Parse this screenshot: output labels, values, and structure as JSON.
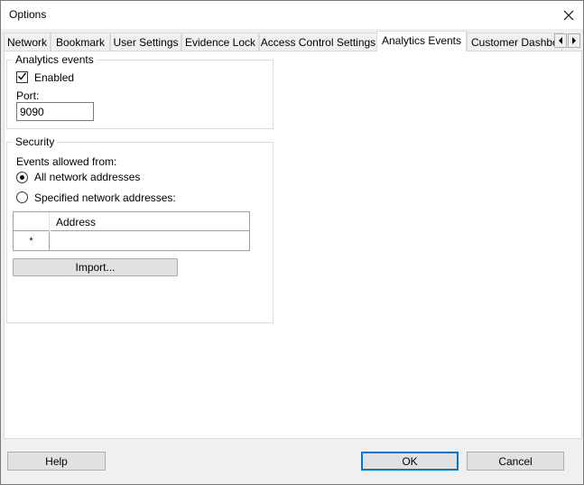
{
  "window": {
    "title": "Options",
    "close_icon": "close-icon"
  },
  "tabs": [
    {
      "label": "Network"
    },
    {
      "label": "Bookmark"
    },
    {
      "label": "User Settings"
    },
    {
      "label": "Evidence Lock"
    },
    {
      "label": "Access Control Settings"
    },
    {
      "label": "Analytics Events",
      "active": true
    },
    {
      "label": "Customer Dashboard"
    }
  ],
  "tab_scroll": {
    "left_icon": "chevron-left-icon",
    "right_icon": "chevron-right-icon"
  },
  "analytics": {
    "group_title": "Analytics events",
    "enabled_label": "Enabled",
    "enabled": true,
    "port_label": "Port:",
    "port_value": "9090"
  },
  "security": {
    "group_title": "Security",
    "allowed_from_label": "Events allowed from:",
    "option_all": "All network addresses",
    "option_specified": "Specified network addresses:",
    "selected": "all",
    "grid": {
      "column_header": "Address",
      "new_row_marker": "*"
    },
    "import_label": "Import..."
  },
  "buttons": {
    "help": "Help",
    "ok": "OK",
    "cancel": "Cancel"
  },
  "colors": {
    "accent": "#0078d7",
    "dialog_bg": "#f0f0f0",
    "button_bg": "#e1e1e1"
  }
}
